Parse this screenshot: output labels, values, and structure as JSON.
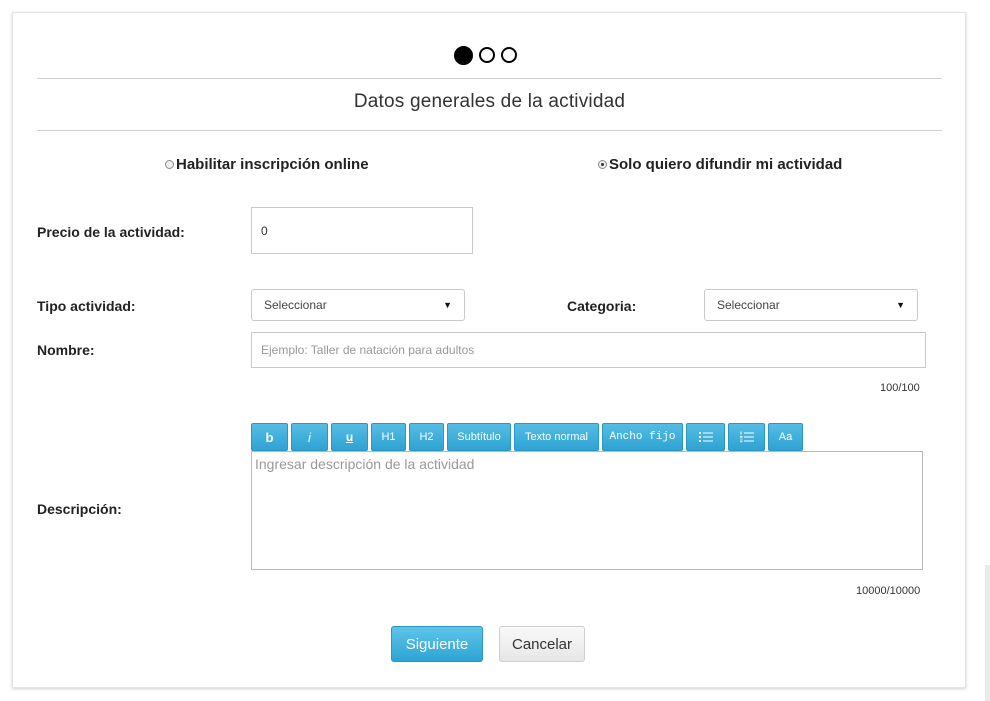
{
  "steps": {
    "total": 3,
    "current": 1
  },
  "title": "Datos generales de la actividad",
  "radios": [
    {
      "label": "Habilitar inscripción online",
      "checked": false
    },
    {
      "label": "Solo quiero difundir mi actividad",
      "checked": true
    }
  ],
  "price": {
    "label": "Precio de la actividad:",
    "value": "0"
  },
  "tipo": {
    "label": "Tipo actividad:",
    "selected": "Seleccionar"
  },
  "categoria": {
    "label": "Categoria:",
    "selected": "Seleccionar"
  },
  "nombre": {
    "label": "Nombre:",
    "placeholder": "Ejemplo: Taller de natación para adultos",
    "counter": "100/100"
  },
  "toolbar": [
    {
      "name": "bold-button",
      "label": "b"
    },
    {
      "name": "italic-button",
      "label": "i"
    },
    {
      "name": "underline-button",
      "label": "u"
    },
    {
      "name": "h1-button",
      "label": "H1"
    },
    {
      "name": "h2-button",
      "label": "H2"
    },
    {
      "name": "subtitle-button",
      "label": "Subtítulo"
    },
    {
      "name": "normal-text-button",
      "label": "Texto normal"
    },
    {
      "name": "monospace-button",
      "label": "Ancho fijo"
    },
    {
      "name": "bullet-list-button",
      "label": "",
      "icon": "bullet-list-icon"
    },
    {
      "name": "numbered-list-button",
      "label": "",
      "icon": "numbered-list-icon"
    },
    {
      "name": "font-size-button",
      "label": "Aa"
    }
  ],
  "descripcion": {
    "label": "Descripción:",
    "placeholder": "Ingresar descripción de la actividad",
    "counter": "10000/10000"
  },
  "buttons": {
    "next": "Siguiente",
    "cancel": "Cancelar"
  },
  "colors": {
    "accent": "#3aaedb"
  }
}
